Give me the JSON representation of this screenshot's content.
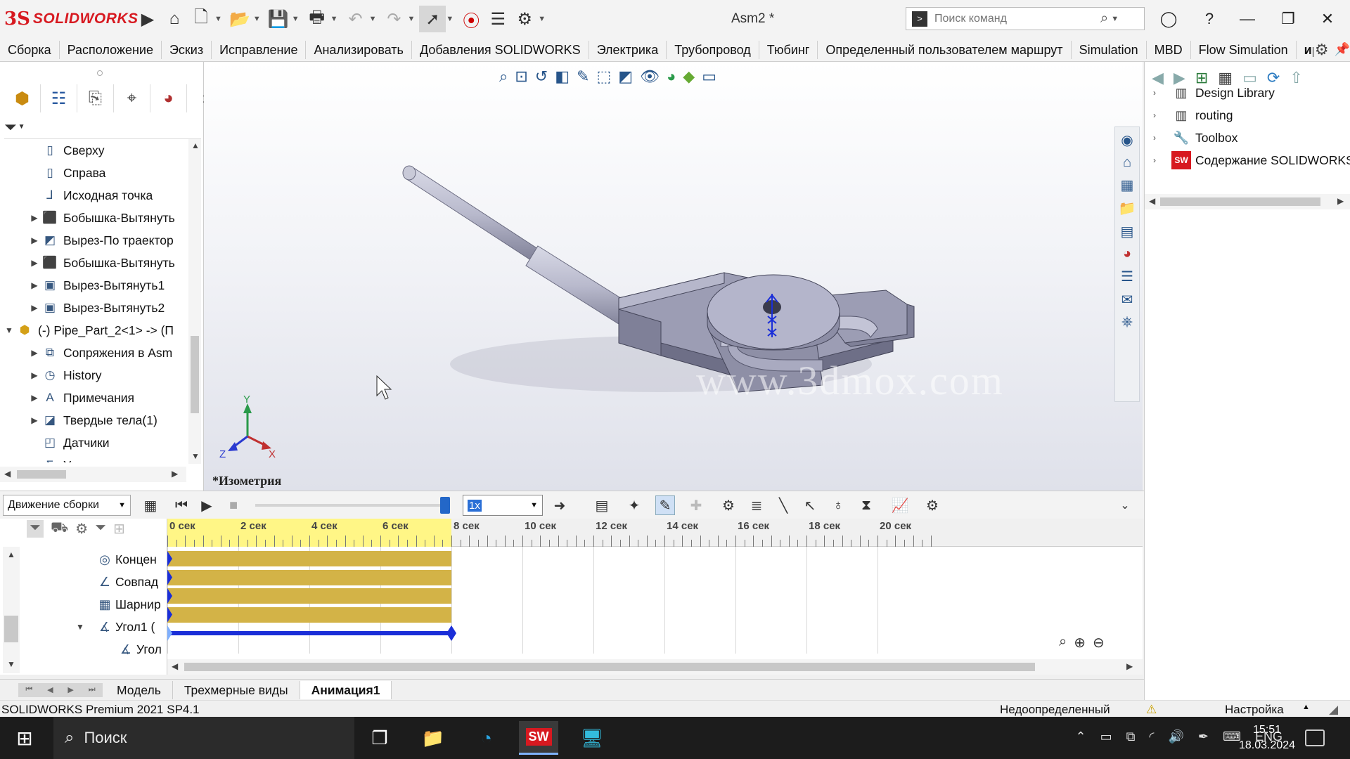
{
  "app": {
    "brand_ds": "3S",
    "brand_word": "SOLIDWORKS",
    "document_title": "Asm2 *"
  },
  "titlebar": {
    "icons": [
      "home-icon",
      "new-document-icon",
      "open-folder-icon",
      "save-icon",
      "print-icon",
      "undo-icon",
      "redo-icon",
      "select-arrow-icon",
      "traffic-light-icon",
      "file-properties-icon",
      "options-gear-icon"
    ],
    "search_placeholder": "Поиск команд"
  },
  "ribbon": {
    "tabs": [
      "Сборка",
      "Расположение",
      "Эскиз",
      "Исправление",
      "Анализировать",
      "Добавления SOLIDWORKS",
      "Электрика",
      "Трубопровод",
      "Тюбинг",
      "Определенный пользователем маршрут",
      "Simulation",
      "MBD",
      "Flow Simulation",
      "иро"
    ]
  },
  "feature_tree": {
    "items": [
      {
        "label": "Сверху",
        "icon": "plane-icon",
        "expandable": false,
        "level": 1
      },
      {
        "label": "Справа",
        "icon": "plane-icon",
        "expandable": false,
        "level": 1
      },
      {
        "label": "Исходная точка",
        "icon": "origin-icon",
        "expandable": false,
        "level": 1
      },
      {
        "label": "Бобышка-Вытянуть",
        "icon": "extrude-boss-icon",
        "expandable": true,
        "level": 1
      },
      {
        "label": "Вырез-По траектор",
        "icon": "swept-cut-icon",
        "expandable": true,
        "level": 1
      },
      {
        "label": "Бобышка-Вытянуть",
        "icon": "extrude-boss-icon",
        "expandable": true,
        "level": 1
      },
      {
        "label": "Вырез-Вытянуть1",
        "icon": "extrude-cut-icon",
        "expandable": true,
        "level": 1
      },
      {
        "label": "Вырез-Вытянуть2",
        "icon": "extrude-cut-icon",
        "expandable": true,
        "level": 1
      },
      {
        "label": "(-) Pipe_Part_2<1> -> (П",
        "icon": "part-icon",
        "expandable": true,
        "expanded": true,
        "level": 0
      },
      {
        "label": "Сопряжения в Asm",
        "icon": "mates-icon",
        "expandable": true,
        "level": 1
      },
      {
        "label": "History",
        "icon": "history-icon",
        "expandable": true,
        "level": 1
      },
      {
        "label": "Примечания",
        "icon": "annotations-icon",
        "expandable": true,
        "level": 1
      },
      {
        "label": "Твердые тела(1)",
        "icon": "solid-bodies-icon",
        "expandable": true,
        "level": 1
      },
      {
        "label": "Датчики",
        "icon": "sensors-icon",
        "expandable": false,
        "level": 1
      },
      {
        "label": "Уравнения",
        "icon": "equations-icon",
        "expandable": true,
        "level": 1
      }
    ]
  },
  "viewport": {
    "view_name": "*Изометрия",
    "watermark": "www.3dmox.com",
    "triad": {
      "x": "X",
      "y": "Y",
      "z": "Z"
    }
  },
  "task_pane": {
    "libraries": [
      {
        "label": "Design Library",
        "icon": "design-library-icon"
      },
      {
        "label": "routing",
        "icon": "design-library-icon"
      },
      {
        "label": "Toolbox",
        "icon": "toolbox-icon"
      },
      {
        "label": "Содержание SOLIDWORKS",
        "icon": "solidworks-content-icon"
      }
    ]
  },
  "motion": {
    "study_type": "Движение сборки",
    "speed": "1x",
    "playback_position": 1.0,
    "timeline_labels": [
      "0 сек",
      "2 сек",
      "4 сек",
      "6 сек",
      "8 сек",
      "10 сек",
      "12 сек",
      "14 сек",
      "16 сек",
      "18 сек",
      "20 сек"
    ],
    "timeline_max_seconds": 21.5,
    "rows": [
      {
        "label": "Концен",
        "icon": "concentric-mate-icon",
        "start": 0,
        "end": 8,
        "style": "gold",
        "indent": 0
      },
      {
        "label": "Совпад",
        "icon": "coincident-mate-icon",
        "start": 0,
        "end": 8,
        "style": "gold",
        "indent": 0
      },
      {
        "label": "Шарнир",
        "icon": "hinge-mate-icon",
        "start": 0,
        "end": 8,
        "style": "gold",
        "indent": 0
      },
      {
        "label": "Угол1 (",
        "icon": "angle-mate-icon",
        "start": 0,
        "end": 8,
        "style": "gold",
        "indent": 1
      },
      {
        "label": "Угол",
        "icon": "angle-mate-icon",
        "start": 0,
        "end": 8,
        "style": "blue",
        "indent": 2
      }
    ]
  },
  "doc_tabs": [
    "Модель",
    "Трехмерные виды",
    "Анимация1"
  ],
  "active_doc_tab": "Анимация1",
  "status": {
    "product": "SOLIDWORKS Premium 2021 SP4.1",
    "definition": "Недоопределенный",
    "customize": "Настройка"
  },
  "taskbar": {
    "search_label": "Поиск",
    "language": "ENG",
    "time": "15:51",
    "date": "18.03.2024"
  },
  "colors": {
    "accent": "#2367c8",
    "brand": "#d71920",
    "bar_gold": "#d3b347",
    "ruler_played": "#fff686",
    "key_blue": "#1a2ed8"
  }
}
